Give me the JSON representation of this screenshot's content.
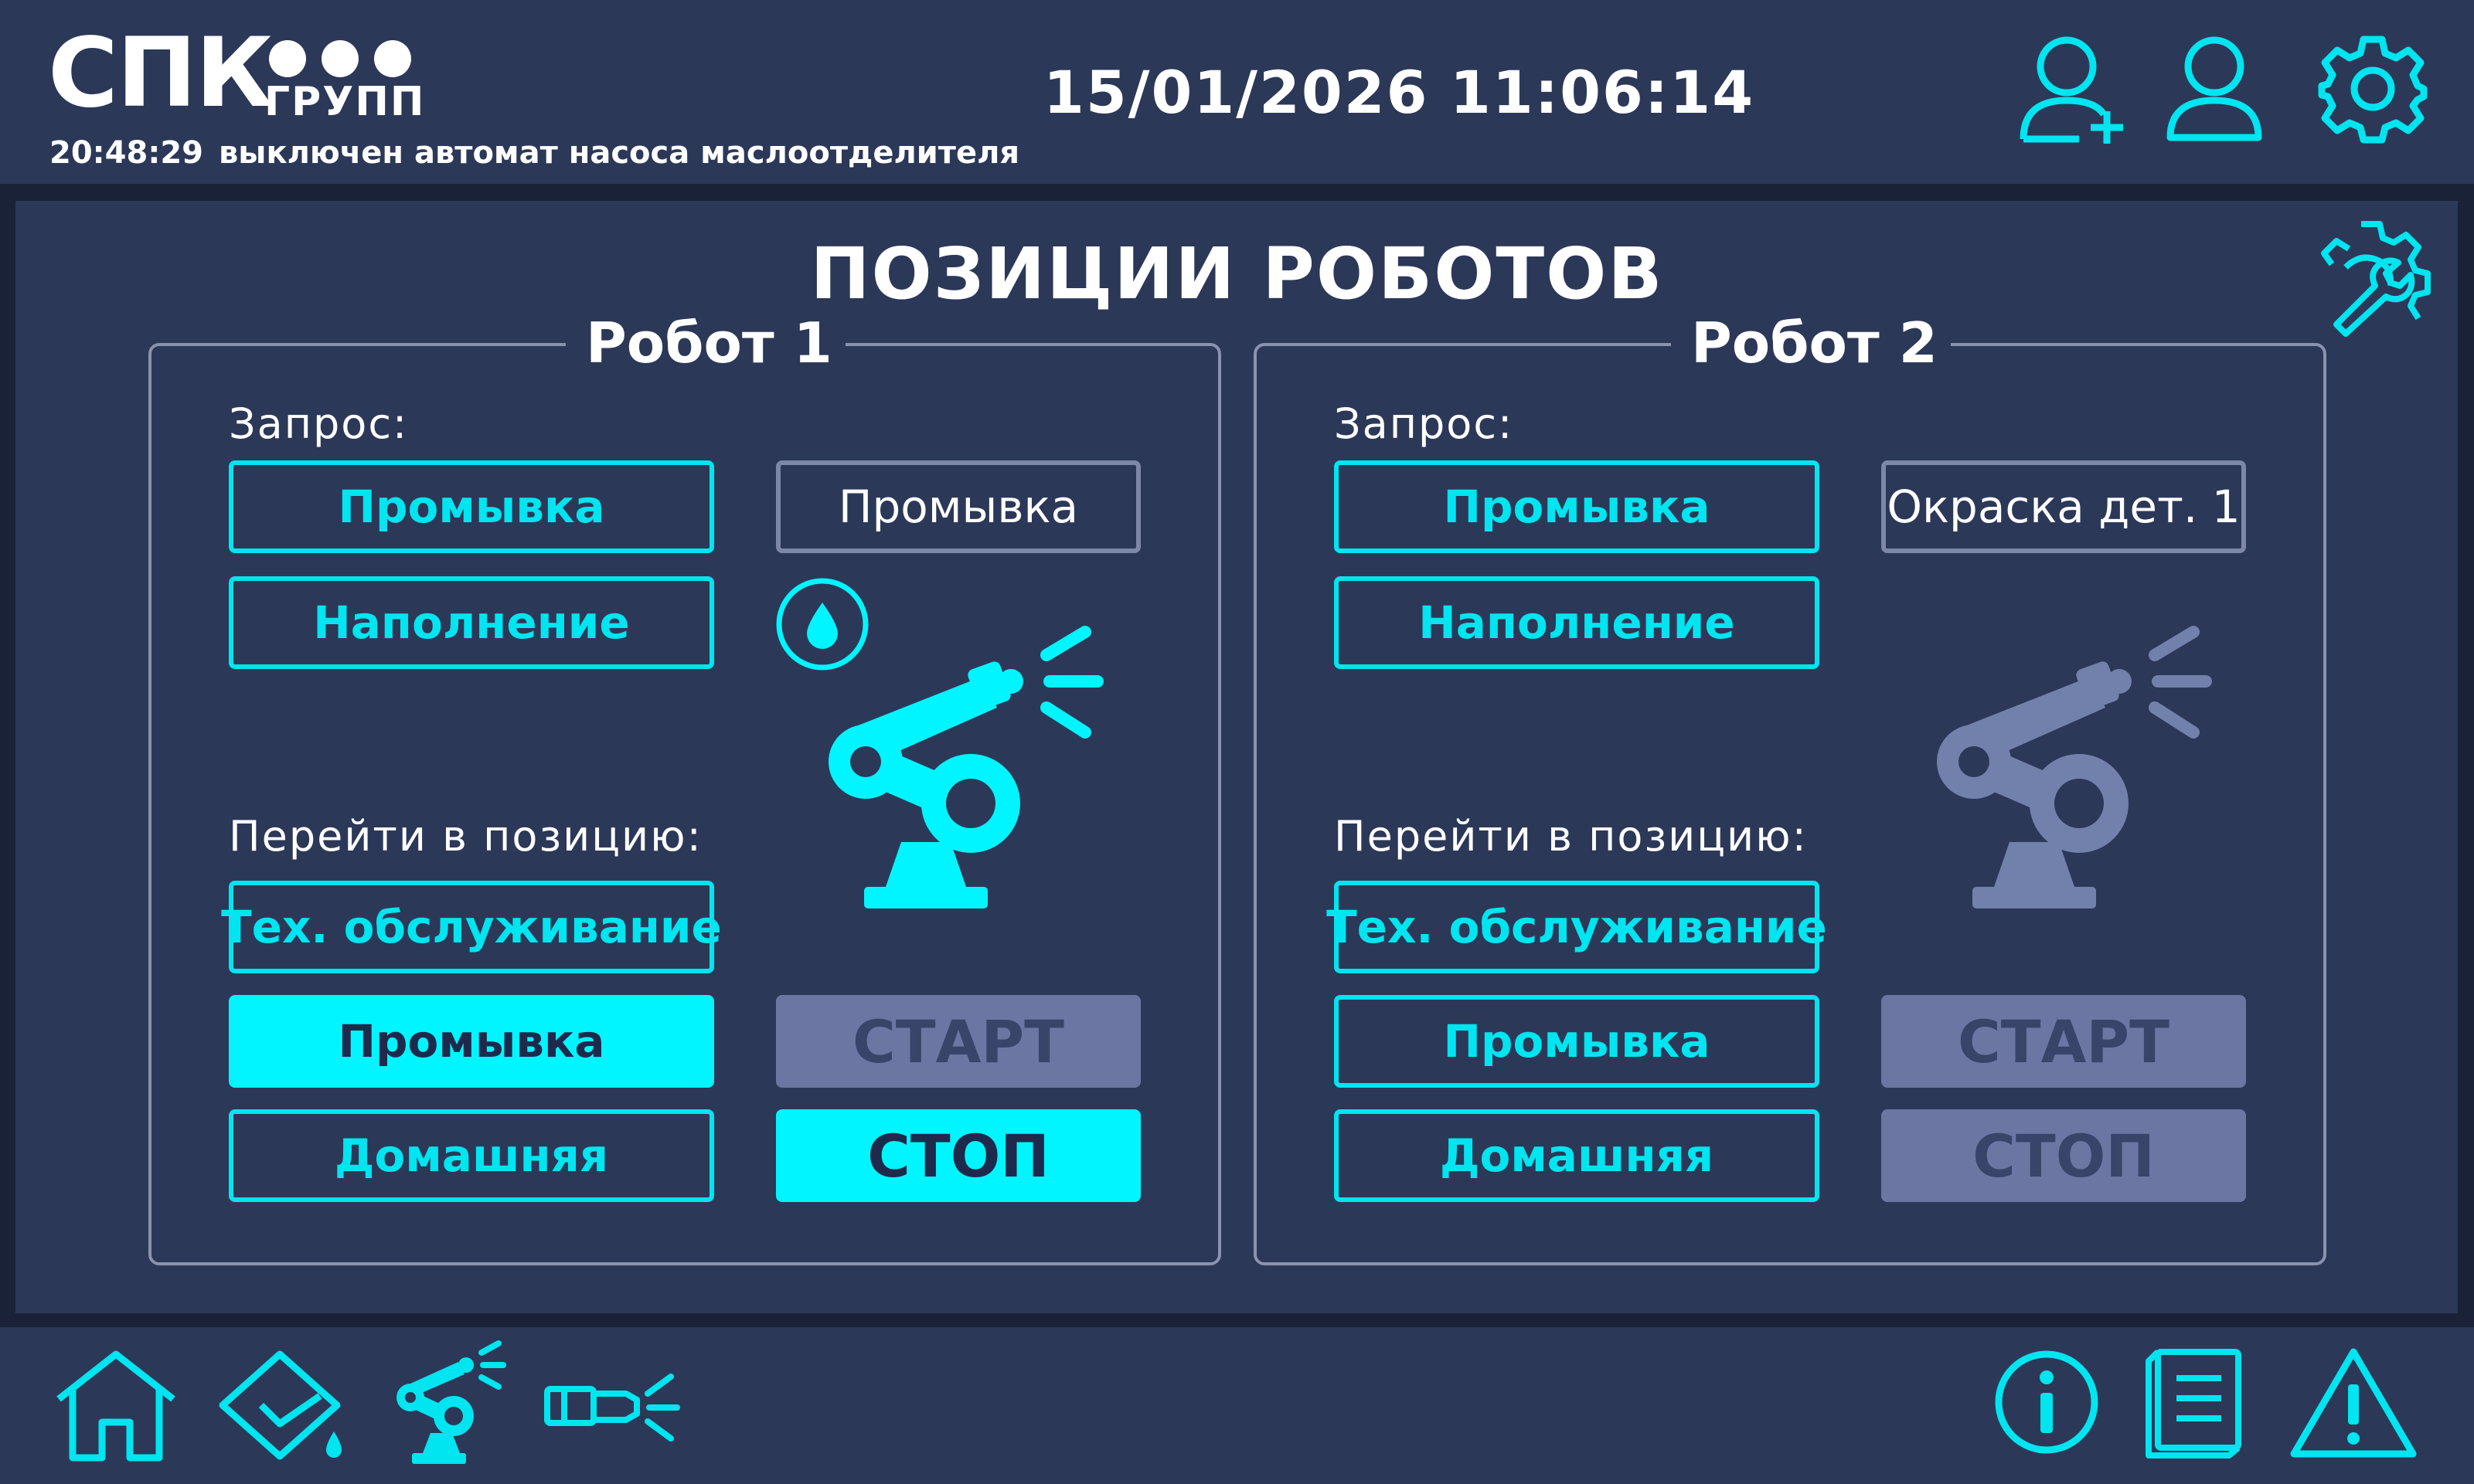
{
  "header": {
    "logo_main": "СПК",
    "logo_sub": "ГРУПП",
    "alarm_time": "20:48:29",
    "alarm_text": "выключен автомат насоса маслоотделителя",
    "date": "15/01/2026",
    "time": "11:06:14",
    "icons": [
      "add-user-icon",
      "user-icon",
      "gear-icon"
    ]
  },
  "main": {
    "title": "ПОЗИЦИИ РОБОТОВ",
    "service_icon": "wrench-gear-icon",
    "robots": [
      {
        "title": "Робот 1",
        "request_label": "Запрос:",
        "request_buttons": [
          "Промывка",
          "Наполнение"
        ],
        "current_request": "Промывка",
        "status_icon": "drop-icon",
        "robot_icon": "robot-arm-icon",
        "robot_active": true,
        "goto_label": "Перейти в позицию:",
        "goto_buttons": [
          "Тех. обслуживание",
          "Промывка",
          "Домашняя"
        ],
        "active_goto": "Промывка",
        "start_label": "СТАРТ",
        "stop_label": "СТОП",
        "stop_active": true
      },
      {
        "title": "Робот 2",
        "request_label": "Запрос:",
        "request_buttons": [
          "Промывка",
          "Наполнение"
        ],
        "current_request": "Окраска дет. 1",
        "robot_icon": "robot-arm-icon",
        "robot_active": false,
        "goto_label": "Перейти в позицию:",
        "goto_buttons": [
          "Тех. обслуживание",
          "Промывка",
          "Домашняя"
        ],
        "active_goto": "",
        "start_label": "СТАРТ",
        "stop_label": "СТОП",
        "stop_active": false
      }
    ]
  },
  "footer": {
    "nav_icons": [
      "home-icon",
      "tank-fill-icon",
      "robot-nav-icon",
      "spray-gun-icon"
    ],
    "right_icons": [
      "info-icon",
      "manual-book-icon",
      "warning-icon"
    ]
  },
  "colors": {
    "accent": "#00f5ff",
    "panel_bg": "#2c3858",
    "background": "#1a2238",
    "inactive": "#6b77a2"
  }
}
